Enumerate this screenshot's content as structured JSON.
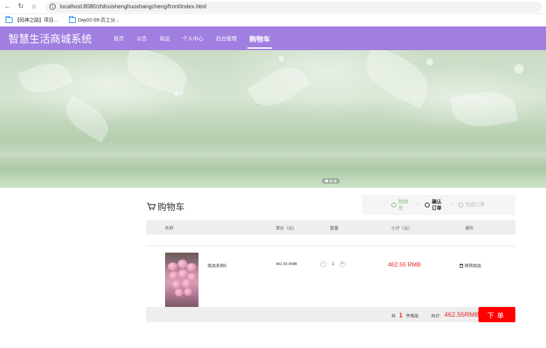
{
  "browser": {
    "url": "localhost:8080/zhihuishenghuoshangcheng/front/index.html",
    "bookmarks": [
      "【码神之路】项目...",
      "Day02-09-员工分..."
    ]
  },
  "header": {
    "brand": "智慧生活商城系统",
    "nav": [
      "首页",
      "公告",
      "商品",
      "个人中心",
      "后台管理",
      "购物车"
    ],
    "active_nav": "购物车"
  },
  "banner": {
    "slides": 3,
    "active_slide": 0
  },
  "cart": {
    "title": "购物车",
    "steps": [
      "购物车",
      "确认订单",
      "完成订单"
    ],
    "columns": [
      "名称",
      "单价（元）",
      "数量",
      "小计（元）",
      "操作"
    ],
    "items": [
      {
        "name": "商品名称5",
        "unit_price": "462.55 RMB",
        "quantity": "1",
        "subtotal": "462.55 RMB",
        "action": "移除商品"
      }
    ],
    "footer": {
      "count_prefix": "共",
      "count": "1",
      "count_suffix": "件商品",
      "total_label": "共计:",
      "total": "462.55RMB",
      "order_button": "下单"
    }
  },
  "colors": {
    "header": "#a07fe0",
    "price": "#e32525",
    "order_button": "#ff0000",
    "step_active": "#7cc576"
  }
}
